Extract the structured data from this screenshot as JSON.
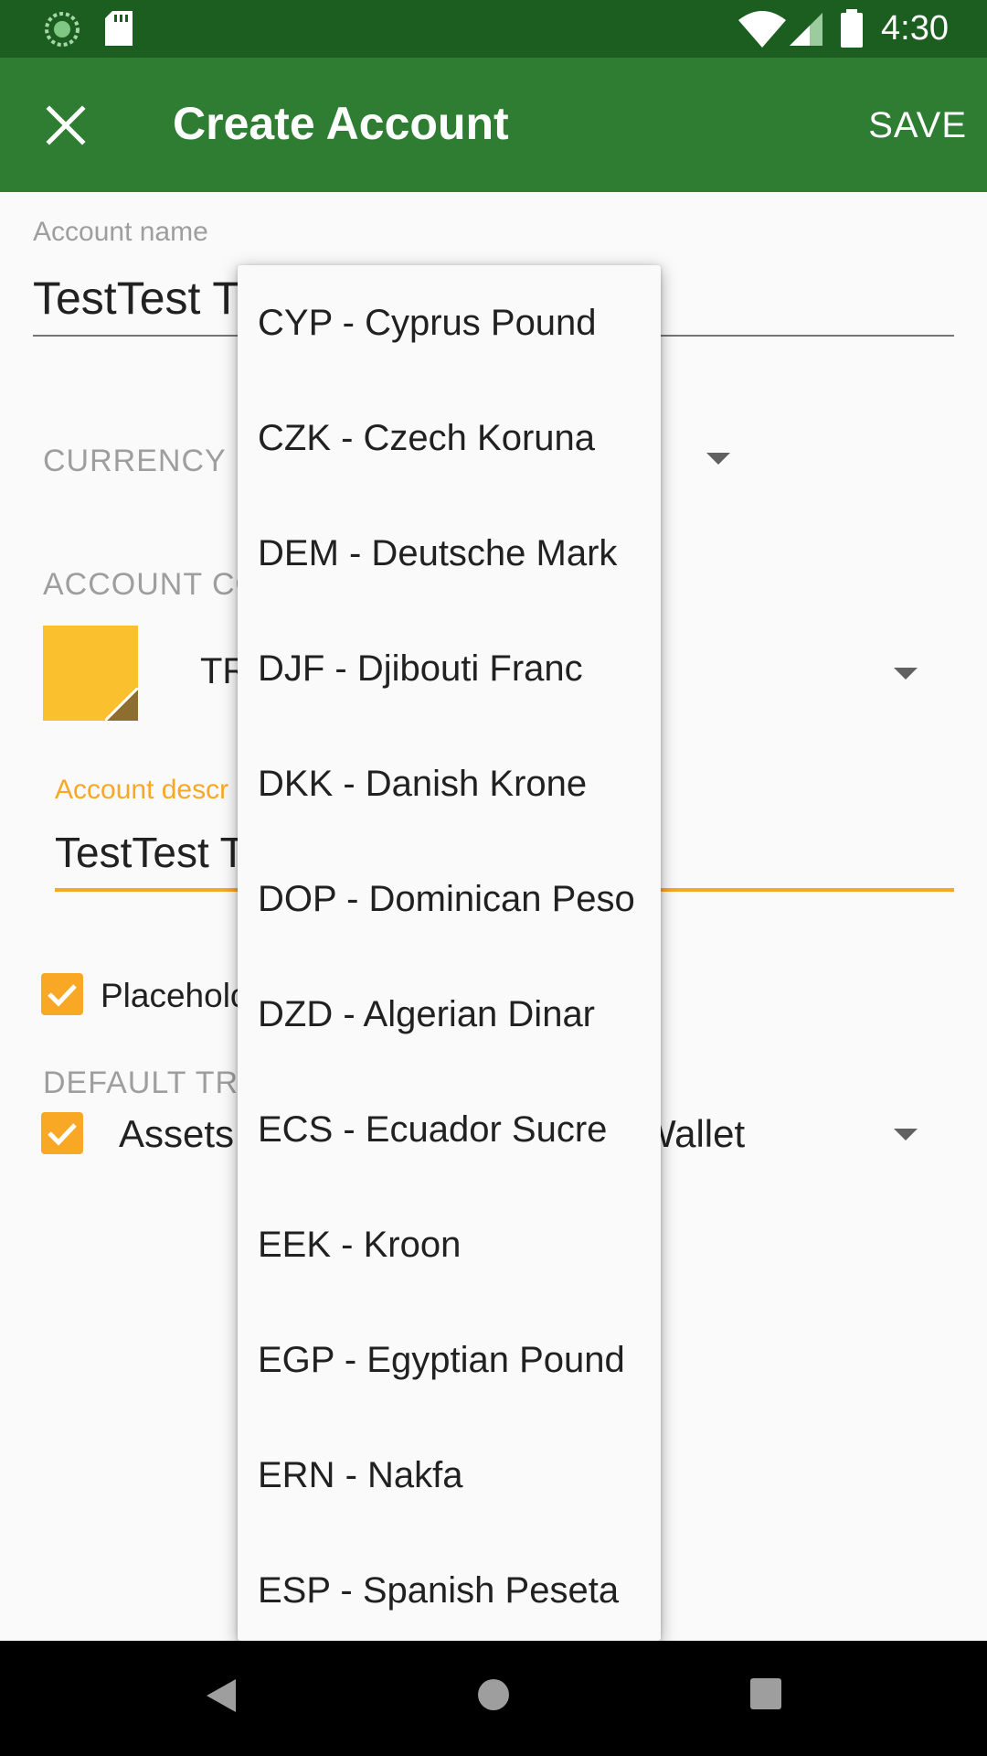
{
  "status_bar": {
    "time": "4:30"
  },
  "toolbar": {
    "title": "Create Account",
    "save_label": "SAVE"
  },
  "form": {
    "account_name_label": "Account name",
    "account_name_value": "TestTest T",
    "currency_label": "CURRENCY",
    "account_color_label": "ACCOUNT CO",
    "account_type_value": "TR",
    "description_label": "Account descr",
    "description_value": "TestTest T",
    "placeholder_label": "Placeholc",
    "default_transfer_label": "DEFAULT TRA",
    "default_transfer_value_left": "Assets",
    "default_transfer_value_right": "Wallet"
  },
  "dropdown": {
    "items": [
      "CYP - Cyprus Pound",
      "CZK - Czech Koruna",
      "DEM - Deutsche Mark",
      "DJF - Djibouti Franc",
      "DKK - Danish Krone",
      "DOP - Dominican Peso",
      "DZD - Algerian Dinar",
      "ECS - Ecuador Sucre",
      "EEK - Kroon",
      "EGP - Egyptian Pound",
      "ERN - Nakfa",
      "ESP - Spanish Peseta"
    ]
  },
  "colors": {
    "status_bar": "#1b5e20",
    "toolbar": "#2e7d32",
    "accent": "#f9a825",
    "account_color_swatch": "#fbc02d"
  },
  "icons": {
    "status": [
      "sync-icon",
      "sd-card-icon",
      "wifi-icon",
      "signal-icon",
      "battery-icon"
    ],
    "toolbar": [
      "close-icon"
    ],
    "nav": [
      "back-icon",
      "home-icon",
      "recents-icon"
    ]
  }
}
